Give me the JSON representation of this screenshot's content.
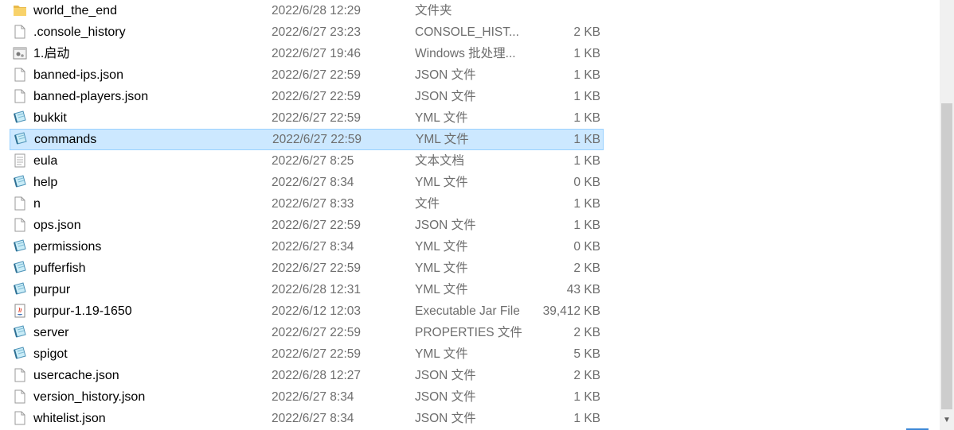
{
  "colors": {
    "selection_fill": "#cce8ff",
    "selection_border": "#99d1ff",
    "detail_text": "#6d6d6d",
    "folder_yellow": "#f8d26a"
  },
  "files": [
    {
      "name": "world_the_end",
      "date": "2022/6/28 12:29",
      "type": "文件夹",
      "size": "",
      "icon": "folder-icon"
    },
    {
      "name": ".console_history",
      "date": "2022/6/27 23:23",
      "type": "CONSOLE_HIST...",
      "size": "2 KB",
      "icon": "blank-file-icon"
    },
    {
      "name": "1.启动",
      "date": "2022/6/27 19:46",
      "type": "Windows 批处理...",
      "size": "1 KB",
      "icon": "batch-file-icon"
    },
    {
      "name": "banned-ips.json",
      "date": "2022/6/27 22:59",
      "type": "JSON 文件",
      "size": "1 KB",
      "icon": "blank-file-icon"
    },
    {
      "name": "banned-players.json",
      "date": "2022/6/27 22:59",
      "type": "JSON 文件",
      "size": "1 KB",
      "icon": "blank-file-icon"
    },
    {
      "name": "bukkit",
      "date": "2022/6/27 22:59",
      "type": "YML 文件",
      "size": "1 KB",
      "icon": "yml-file-icon"
    },
    {
      "name": "commands",
      "date": "2022/6/27 22:59",
      "type": "YML 文件",
      "size": "1 KB",
      "icon": "yml-file-icon",
      "selected": true
    },
    {
      "name": "eula",
      "date": "2022/6/27 8:25",
      "type": "文本文档",
      "size": "1 KB",
      "icon": "text-file-icon"
    },
    {
      "name": "help",
      "date": "2022/6/27 8:34",
      "type": "YML 文件",
      "size": "0 KB",
      "icon": "yml-file-icon"
    },
    {
      "name": "n",
      "date": "2022/6/27 8:33",
      "type": "文件",
      "size": "1 KB",
      "icon": "blank-file-icon"
    },
    {
      "name": "ops.json",
      "date": "2022/6/27 22:59",
      "type": "JSON 文件",
      "size": "1 KB",
      "icon": "blank-file-icon"
    },
    {
      "name": "permissions",
      "date": "2022/6/27 8:34",
      "type": "YML 文件",
      "size": "0 KB",
      "icon": "yml-file-icon"
    },
    {
      "name": "pufferfish",
      "date": "2022/6/27 22:59",
      "type": "YML 文件",
      "size": "2 KB",
      "icon": "yml-file-icon"
    },
    {
      "name": "purpur",
      "date": "2022/6/28 12:31",
      "type": "YML 文件",
      "size": "43 KB",
      "icon": "yml-file-icon"
    },
    {
      "name": "purpur-1.19-1650",
      "date": "2022/6/12 12:03",
      "type": "Executable Jar File",
      "size": "39,412 KB",
      "icon": "java-jar-icon"
    },
    {
      "name": "server",
      "date": "2022/6/27 22:59",
      "type": "PROPERTIES 文件",
      "size": "2 KB",
      "icon": "yml-file-icon"
    },
    {
      "name": "spigot",
      "date": "2022/6/27 22:59",
      "type": "YML 文件",
      "size": "5 KB",
      "icon": "yml-file-icon"
    },
    {
      "name": "usercache.json",
      "date": "2022/6/28 12:27",
      "type": "JSON 文件",
      "size": "2 KB",
      "icon": "blank-file-icon"
    },
    {
      "name": "version_history.json",
      "date": "2022/6/27 8:34",
      "type": "JSON 文件",
      "size": "1 KB",
      "icon": "blank-file-icon"
    },
    {
      "name": "whitelist.json",
      "date": "2022/6/27 8:34",
      "type": "JSON 文件",
      "size": "1 KB",
      "icon": "blank-file-icon"
    }
  ]
}
